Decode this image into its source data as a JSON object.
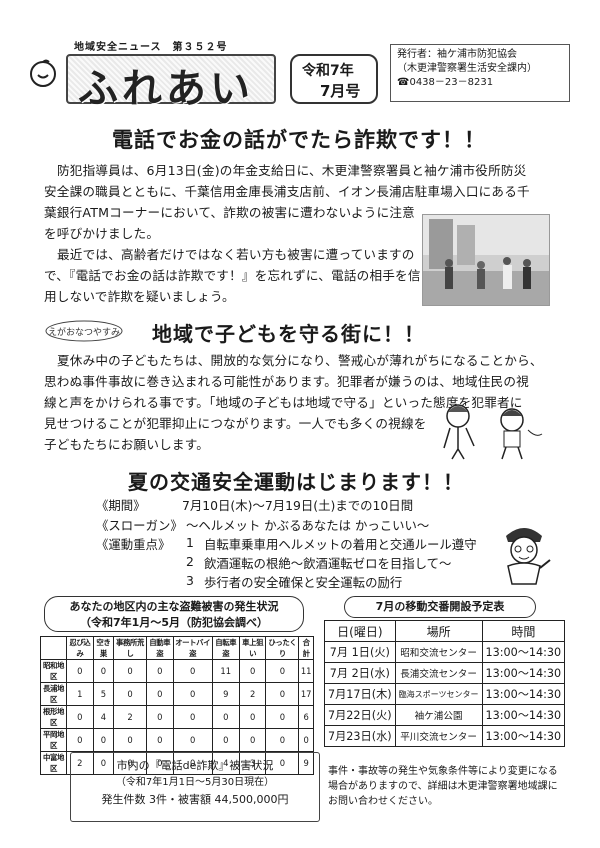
{
  "masthead": {
    "issue_line": "地域安全ニュース　第３５２号",
    "title": "ふれあい",
    "date_line1": "令和7年",
    "date_line2": "7月号",
    "publisher_line1": "発行者：袖ケ浦市防犯協会",
    "publisher_line2": "（木更津警察署生活安全課内）",
    "publisher_line3": "☎0438－23－8231"
  },
  "article1": {
    "headline": "電話でお金の話がでたら詐欺です！！",
    "lines": [
      "防犯指導員は、6月13日(金)の年金支給日に、木更津警察署員と袖ケ浦市役所防災",
      "安全課の職員とともに、千葉信用金庫長浦支店前、イオン長浦店駐車場入口にある千",
      "葉銀行ATMコーナーにおいて、詐欺の被害に遭わないように注意",
      "を呼びかけました。",
      "最近では、高齢者だけではなく若い方も被害に遭っていますの",
      "で、『電話でお金の話は詐欺です！』を忘れずに、電話の相手を信",
      "用しないで詐欺を疑いましょう。"
    ]
  },
  "article2": {
    "badge": "えがおなつやすみ",
    "headline": "地域で子どもを守る街に！！",
    "lines": [
      "夏休み中の子どもたちは、開放的な気分になり、警戒心が薄れがちになることから、",
      "思わぬ事件事故に巻き込まれる可能性があります。犯罪者が嫌うのは、地域住民の視",
      "線と声をかけられる事です。「地域の子どもは地域で守る」といった態度を犯罪者に",
      "見せつけることが犯罪抑止につながります。一人でも多くの視線を",
      "子どもたちにお願いします。"
    ]
  },
  "article3": {
    "headline": "夏の交通安全運動はじまります！！",
    "period_label": "《期間》",
    "period_value": "7月10日(木)～7月19日(土)までの10日間",
    "slogan_label": "《スローガン》",
    "slogan_value": "～ヘルメット かぶるあなたは かっこいい～",
    "focus_label": "《運動重点》",
    "focus_items": [
      {
        "num": "1",
        "text": "自転車乗車用ヘルメットの着用と交通ルール遵守"
      },
      {
        "num": "2",
        "text": "飲酒運転の根絶～飲酒運転ゼロを目指して～"
      },
      {
        "num": "3",
        "text": "歩行者の安全確保と安全運転の励行"
      }
    ]
  },
  "theft": {
    "title_line1": "あなたの地区内の主な盗難被害の発生状況",
    "title_line2": "（令和7年1月～5月（防犯協会調べ）",
    "columns": [
      "",
      "忍び込み",
      "空き巣",
      "事務所荒し",
      "自動車盗",
      "オートバイ盗",
      "自転車盗",
      "車上狙い",
      "ひったくり",
      "合計"
    ],
    "rows": [
      {
        "area": "昭和地区",
        "values": [
          "0",
          "0",
          "0",
          "0",
          "0",
          "11",
          "0",
          "0",
          "11"
        ]
      },
      {
        "area": "長浦地区",
        "values": [
          "1",
          "5",
          "0",
          "0",
          "0",
          "9",
          "2",
          "0",
          "17"
        ]
      },
      {
        "area": "根形地区",
        "values": [
          "0",
          "4",
          "2",
          "0",
          "0",
          "0",
          "0",
          "0",
          "6"
        ]
      },
      {
        "area": "平岡地区",
        "values": [
          "0",
          "0",
          "0",
          "0",
          "0",
          "0",
          "0",
          "0",
          "0"
        ]
      },
      {
        "area": "中富地区",
        "values": [
          "2",
          "0",
          "0",
          "0",
          "0",
          "4",
          "3",
          "0",
          "9"
        ]
      }
    ]
  },
  "fraud": {
    "line1": "市内の『電話de詐欺』被害状況",
    "line2": "（令和7年1月1日～5月30日現在）",
    "line3": "発生件数 3件・被害額 44,500,000円"
  },
  "schedule": {
    "title": "7月の移動交番開設予定表",
    "headers": [
      "日(曜日)",
      "場所",
      "時間"
    ],
    "rows": [
      {
        "date": "7月 1日(火)",
        "place": "昭和交流センター",
        "time": "13:00～14:30"
      },
      {
        "date": "7月 2日(水)",
        "place": "長浦交流センター",
        "time": "13:00～14:30"
      },
      {
        "date": "7月17日(木)",
        "place": "臨海スポーツセンター",
        "time": "13:00～14:30"
      },
      {
        "date": "7月22日(火)",
        "place": "袖ケ浦公園",
        "time": "13:00～14:30"
      },
      {
        "date": "7月23日(水)",
        "place": "平川交流センター",
        "time": "13:00～14:30"
      }
    ],
    "note": "事件・事故等の発生や気象条件等により変更になる場合がありますので、詳細は木更津警察署地域課にお問い合わせください。"
  }
}
